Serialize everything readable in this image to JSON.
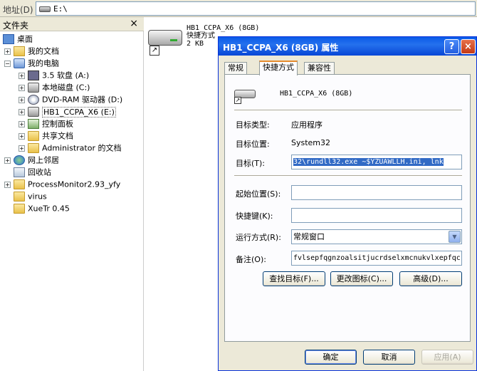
{
  "address": {
    "label": "地址(D)",
    "path": "E:\\"
  },
  "folder_pane": {
    "title": "文件夹",
    "close": "×",
    "items": [
      {
        "label": "桌面",
        "icon": "desktop-icon",
        "expander": ""
      },
      {
        "label": "我的文档",
        "icon": "my-documents-icon",
        "expander": "+"
      },
      {
        "label": "我的电脑",
        "icon": "my-computer-icon",
        "expander": "−"
      },
      {
        "label": "3.5 软盘 (A:)",
        "icon": "floppy-drive-icon",
        "expander": "+"
      },
      {
        "label": "本地磁盘 (C:)",
        "icon": "local-disk-icon",
        "expander": "+"
      },
      {
        "label": "DVD-RAM 驱动器 (D:)",
        "icon": "dvd-drive-icon",
        "expander": "+"
      },
      {
        "label": "HB1_CCPA_X6 (E:)",
        "icon": "removable-drive-icon",
        "expander": "+"
      },
      {
        "label": "控制面板",
        "icon": "control-panel-icon",
        "expander": "+"
      },
      {
        "label": "共享文档",
        "icon": "folder-icon",
        "expander": "+"
      },
      {
        "label": "Administrator 的文档",
        "icon": "folder-icon",
        "expander": "+"
      },
      {
        "label": "网上邻居",
        "icon": "network-icon",
        "expander": "+"
      },
      {
        "label": "回收站",
        "icon": "recycle-bin-icon",
        "expander": ""
      },
      {
        "label": "ProcessMonitor2.93_yfy",
        "icon": "folder-icon",
        "expander": "+"
      },
      {
        "label": "virus",
        "icon": "folder-icon",
        "expander": ""
      },
      {
        "label": "XueTr 0.45",
        "icon": "folder-icon",
        "expander": ""
      }
    ]
  },
  "content": {
    "item_name": "HB1_CCPA_X6 (8GB)",
    "item_type": "快捷方式",
    "item_size": "2 KB"
  },
  "dialog": {
    "title": "HB1_CCPA_X6 (8GB) 属性",
    "help": "?",
    "close": "×",
    "tabs": [
      "常规",
      "快捷方式",
      "兼容性"
    ],
    "shortcut_name": "HB1_CCPA_X6 (8GB)",
    "target_type_label": "目标类型:",
    "target_type_value": "应用程序",
    "target_location_label": "目标位置:",
    "target_location_value": "System32",
    "target_label": "目标(T):",
    "target_value": "32\\rundll32.exe ~$YZUAWLLH.ini,   lnk",
    "start_in_label": "起始位置(S):",
    "start_in_value": "",
    "hotkey_label": "快捷键(K):",
    "hotkey_value": "",
    "run_label": "运行方式(R):",
    "run_value": "常规窗口",
    "comment_label": "备注(O):",
    "comment_value": "fvlsepfqgnzoalsitjucrdselxmcnukvlxepfqc",
    "find_target_button": "查找目标(F)...",
    "change_icon_button": "更改图标(C)...",
    "advanced_button": "高级(D)...",
    "ok_button": "确定",
    "cancel_button": "取消",
    "apply_button": "应用(A)"
  }
}
